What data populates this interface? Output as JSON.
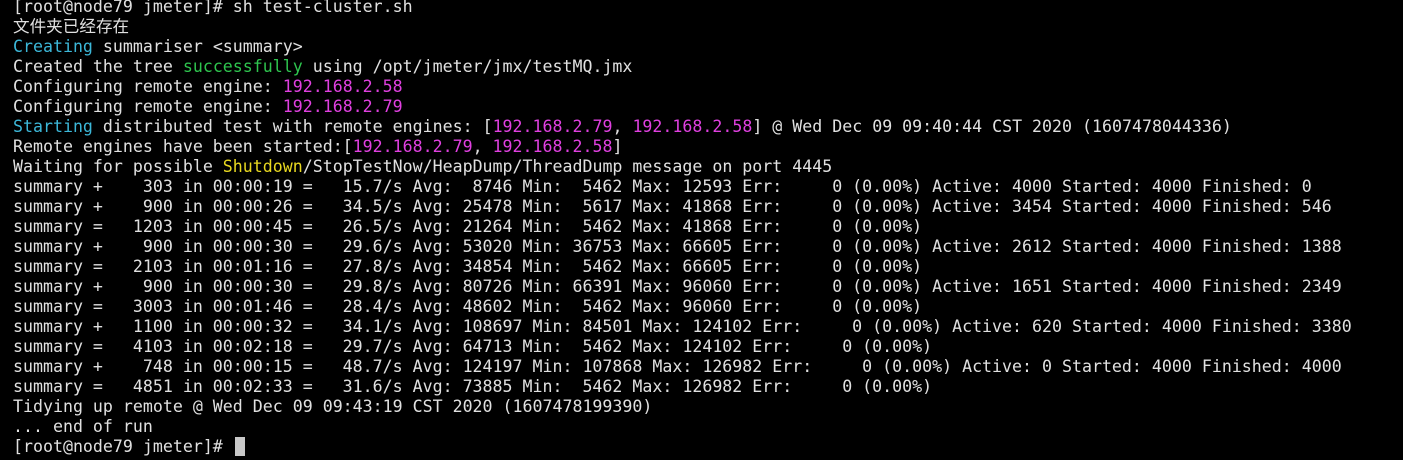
{
  "colors": {
    "background": "#000000",
    "text": "#e0e0e0",
    "cyan": "#3cb7d8",
    "green": "#2ec44e",
    "magenta": "#e040e0",
    "yellow": "#e8d820",
    "cursor": "#c8c8c8"
  },
  "lines": [
    [
      {
        "t": "[root@node79 jmeter]# sh test-cluster.sh"
      }
    ],
    [
      {
        "t": "文件夹已经存在"
      }
    ],
    [
      {
        "t": "Creating",
        "c": "cyan"
      },
      {
        "t": " summariser <summary>"
      }
    ],
    [
      {
        "t": "Created the tree "
      },
      {
        "t": "successfully",
        "c": "green"
      },
      {
        "t": " using /opt/jmeter/jmx/testMQ.jmx"
      }
    ],
    [
      {
        "t": "Configuring remote engine: "
      },
      {
        "t": "192.168.2.58",
        "c": "magenta"
      }
    ],
    [
      {
        "t": "Configuring remote engine: "
      },
      {
        "t": "192.168.2.79",
        "c": "magenta"
      }
    ],
    [
      {
        "t": "Starting",
        "c": "cyan"
      },
      {
        "t": " distributed test with remote engines: ["
      },
      {
        "t": "192.168.2.79",
        "c": "magenta"
      },
      {
        "t": ", "
      },
      {
        "t": "192.168.2.58",
        "c": "magenta"
      },
      {
        "t": "] @ Wed Dec 09 09:40:44 CST 2020 (1607478044336)"
      }
    ],
    [
      {
        "t": "Remote engines have been started:["
      },
      {
        "t": "192.168.2.79",
        "c": "magenta"
      },
      {
        "t": ", "
      },
      {
        "t": "192.168.2.58",
        "c": "magenta"
      },
      {
        "t": "]"
      }
    ],
    [
      {
        "t": "Waiting for possible "
      },
      {
        "t": "Shutdown",
        "c": "yellow"
      },
      {
        "t": "/StopTestNow/HeapDump/ThreadDump message on port 4445"
      }
    ],
    [
      {
        "t": "summary +    303 in 00:00:19 =   15.7/s Avg:  8746 Min:  5462 Max: 12593 Err:     0 (0.00%) Active: 4000 Started: 4000 Finished: 0"
      }
    ],
    [
      {
        "t": "summary +    900 in 00:00:26 =   34.5/s Avg: 25478 Min:  5617 Max: 41868 Err:     0 (0.00%) Active: 3454 Started: 4000 Finished: 546"
      }
    ],
    [
      {
        "t": "summary =   1203 in 00:00:45 =   26.5/s Avg: 21264 Min:  5462 Max: 41868 Err:     0 (0.00%)"
      }
    ],
    [
      {
        "t": "summary +    900 in 00:00:30 =   29.6/s Avg: 53020 Min: 36753 Max: 66605 Err:     0 (0.00%) Active: 2612 Started: 4000 Finished: 1388"
      }
    ],
    [
      {
        "t": "summary =   2103 in 00:01:16 =   27.8/s Avg: 34854 Min:  5462 Max: 66605 Err:     0 (0.00%)"
      }
    ],
    [
      {
        "t": "summary +    900 in 00:00:30 =   29.8/s Avg: 80726 Min: 66391 Max: 96060 Err:     0 (0.00%) Active: 1651 Started: 4000 Finished: 2349"
      }
    ],
    [
      {
        "t": "summary =   3003 in 00:01:46 =   28.4/s Avg: 48602 Min:  5462 Max: 96060 Err:     0 (0.00%)"
      }
    ],
    [
      {
        "t": "summary +   1100 in 00:00:32 =   34.1/s Avg: 108697 Min: 84501 Max: 124102 Err:     0 (0.00%) Active: 620 Started: 4000 Finished: 3380"
      }
    ],
    [
      {
        "t": "summary =   4103 in 00:02:18 =   29.7/s Avg: 64713 Min:  5462 Max: 124102 Err:     0 (0.00%)"
      }
    ],
    [
      {
        "t": "summary +    748 in 00:00:15 =   48.7/s Avg: 124197 Min: 107868 Max: 126982 Err:     0 (0.00%) Active: 0 Started: 4000 Finished: 4000"
      }
    ],
    [
      {
        "t": "summary =   4851 in 00:02:33 =   31.6/s Avg: 73885 Min:  5462 Max: 126982 Err:     0 (0.00%)"
      }
    ],
    [
      {
        "t": "Tidying up remote @ Wed Dec 09 09:43:19 CST 2020 (1607478199390)"
      }
    ],
    [
      {
        "t": "... end of run"
      }
    ],
    [
      {
        "t": "[root@node79 jmeter]# "
      }
    ]
  ]
}
